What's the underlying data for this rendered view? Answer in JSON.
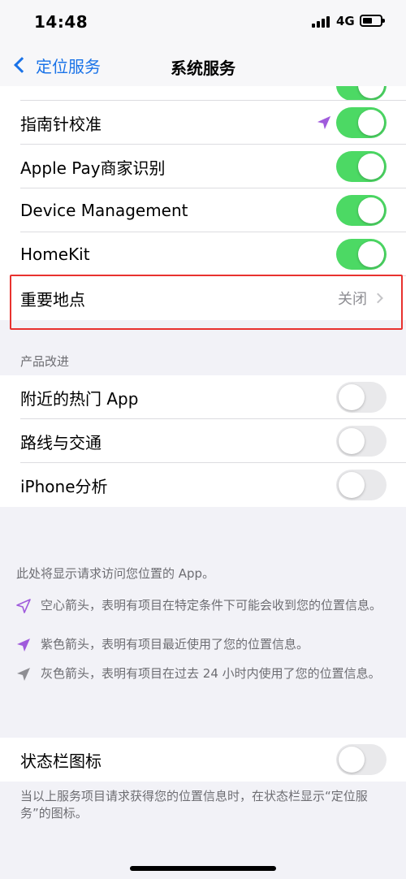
{
  "status_bar": {
    "time": "14:48",
    "network": "4G"
  },
  "nav": {
    "back_label": "定位服务",
    "title": "系统服务"
  },
  "system_services": [
    {
      "label": "指南针校准",
      "toggle": "on",
      "recent_location_arrow": true
    },
    {
      "label": "Apple Pay商家识别",
      "toggle": "on"
    },
    {
      "label": "Device Management",
      "toggle": "on"
    },
    {
      "label": "HomeKit",
      "toggle": "on"
    },
    {
      "label": "重要地点",
      "value": "关闭"
    }
  ],
  "product_improvement": {
    "header": "产品改进",
    "items": [
      {
        "label": "附近的热门 App",
        "toggle": "off"
      },
      {
        "label": "路线与交通",
        "toggle": "off"
      },
      {
        "label": "iPhone分析",
        "toggle": "off"
      }
    ]
  },
  "legend": {
    "intro": "此处将显示请求访问您位置的 App。",
    "items": [
      {
        "icon": "hollow-arrow-icon",
        "text": "空心箭头，表明有项目在特定条件下可能会收到您的位置信息。"
      },
      {
        "icon": "purple-arrow-icon",
        "text": "紫色箭头，表明有项目最近使用了您的位置信息。"
      },
      {
        "icon": "gray-arrow-icon",
        "text": "灰色箭头，表明有项目在过去 24 小时内使用了您的位置信息。"
      }
    ]
  },
  "status_bar_icon": {
    "label": "状态栏图标",
    "toggle": "off",
    "footer": "当以上服务项目请求获得您的位置信息时，在状态栏显示“定位服务”的图标。"
  },
  "colors": {
    "accent": "#1a73e8",
    "toggle_on": "#4cd964",
    "toggle_off": "#e9e9eb",
    "arrow_purple": "#a05bdc",
    "arrow_gray": "#8e8e93",
    "highlight": "#e8322f"
  }
}
